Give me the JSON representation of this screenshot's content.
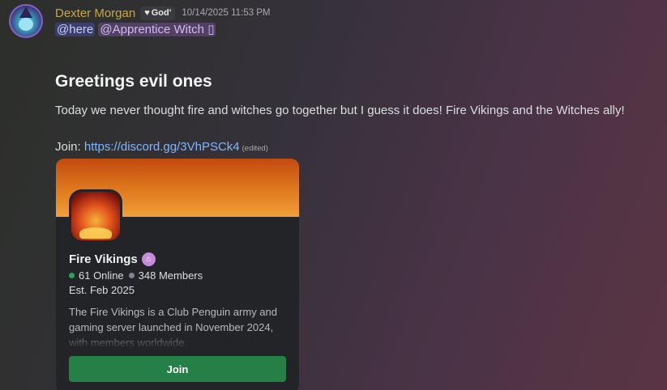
{
  "message": {
    "author": "Dexter Morgan",
    "role_tag": "God'",
    "timestamp": "10/14/2025 11:53 PM",
    "mention_here": "@here",
    "mention_role": "@Apprentice Witch",
    "mention_role_suffix": "▯",
    "heading": "Greetings evil ones",
    "body": "Today we never thought fire and witches go together but I guess it does! Fire Vikings and the Witches ally!",
    "join_label": "Join: ",
    "invite_link": "https://discord.gg/3VhPSCk4",
    "edited": "(edited)"
  },
  "invite": {
    "server_name": "Fire Vikings",
    "online": "61 Online",
    "members": "348 Members",
    "established": "Est. Feb 2025",
    "description": "The Fire Vikings is a Club Penguin army and gaming server launched in November 2024, with members worldwide.",
    "join_button": "Join"
  },
  "colors": {
    "username": "#c8a74a",
    "link": "#7eb6ff",
    "join_button": "#248046",
    "online_dot": "#23a55a"
  },
  "icons": {
    "avatar": "wizard-avatar",
    "role_tag": "heart-icon",
    "server_badge": "community-house-icon"
  }
}
